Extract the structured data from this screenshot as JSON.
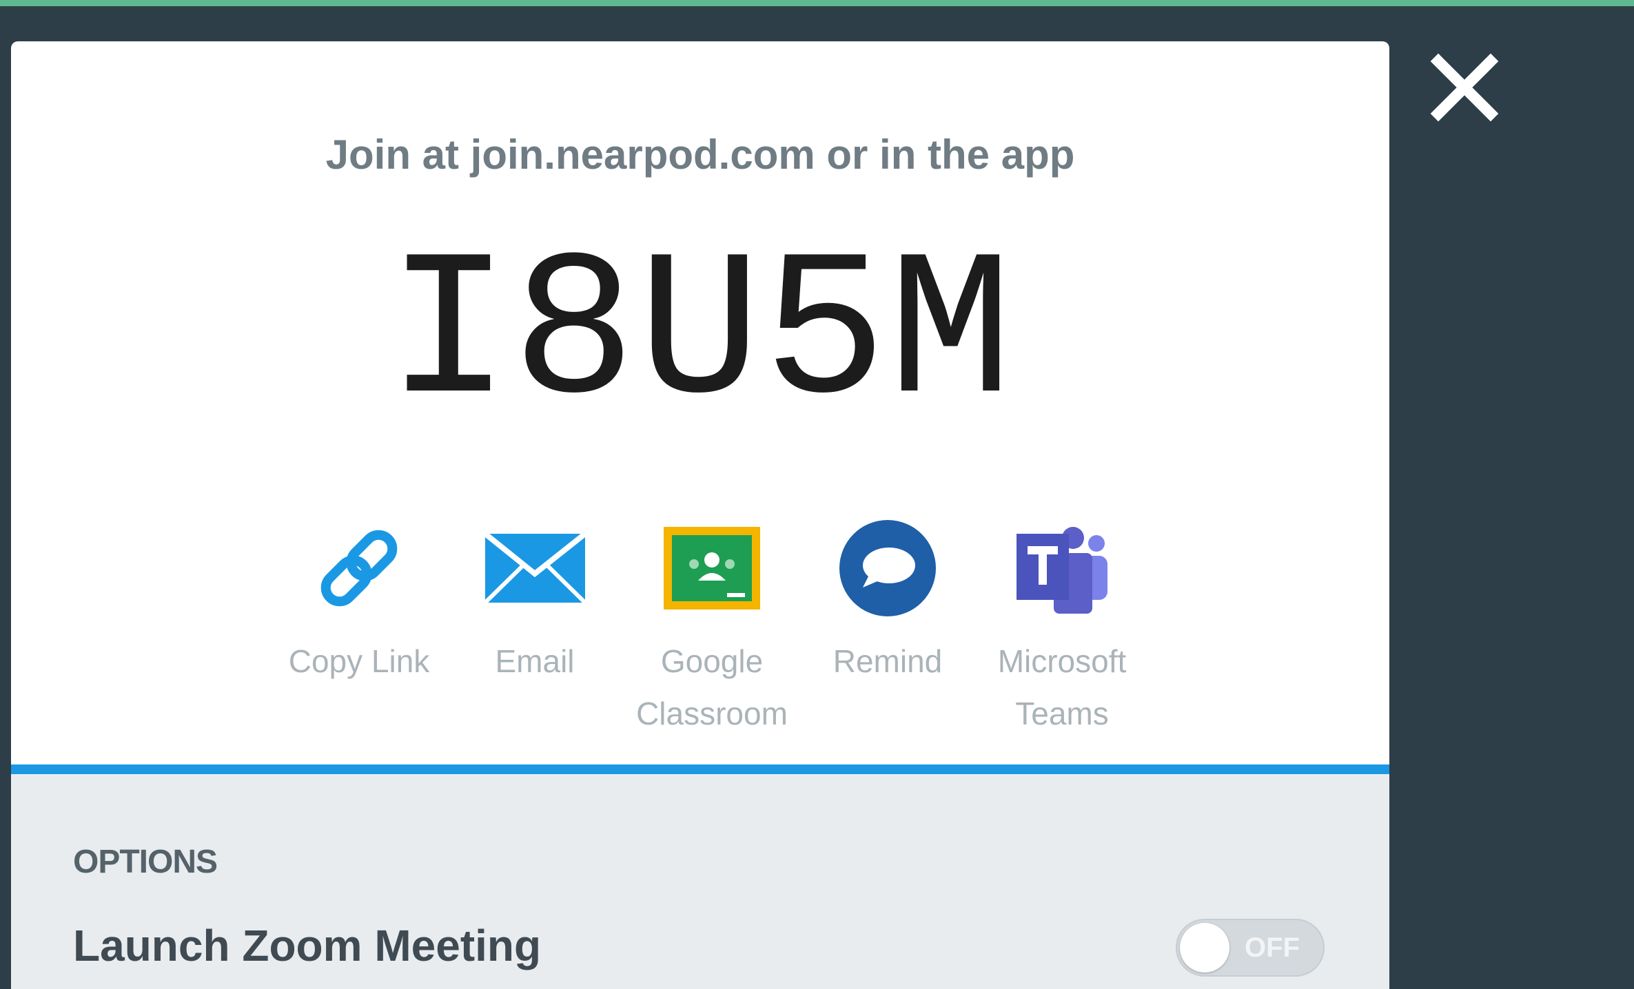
{
  "modal": {
    "join_text": "Join at join.nearpod.com or in the app",
    "join_code": "I8U5M",
    "close_icon": "close-icon",
    "share_options": [
      {
        "label_line1": "Copy Link",
        "label_line2": "",
        "icon": "link-icon",
        "color": "#1a98e3"
      },
      {
        "label_line1": "Email",
        "label_line2": "",
        "icon": "envelope-icon",
        "color": "#1a98e3"
      },
      {
        "label_line1": "Google",
        "label_line2": "Classroom",
        "icon": "google-classroom-icon",
        "color": "#2a9a48"
      },
      {
        "label_line1": "Remind",
        "label_line2": "",
        "icon": "remind-icon",
        "color": "#1f5fa8"
      },
      {
        "label_line1": "Microsoft",
        "label_line2": "Teams",
        "icon": "microsoft-teams-icon",
        "color": "#5b5fc7"
      }
    ]
  },
  "options": {
    "title": "OPTIONS",
    "launch_zoom_label": "Launch Zoom Meeting",
    "toggle_state": "OFF"
  },
  "colors": {
    "backdrop": "#2d3e48",
    "accent_bar": "#1a98e3",
    "top_strip": "#5fb890"
  }
}
